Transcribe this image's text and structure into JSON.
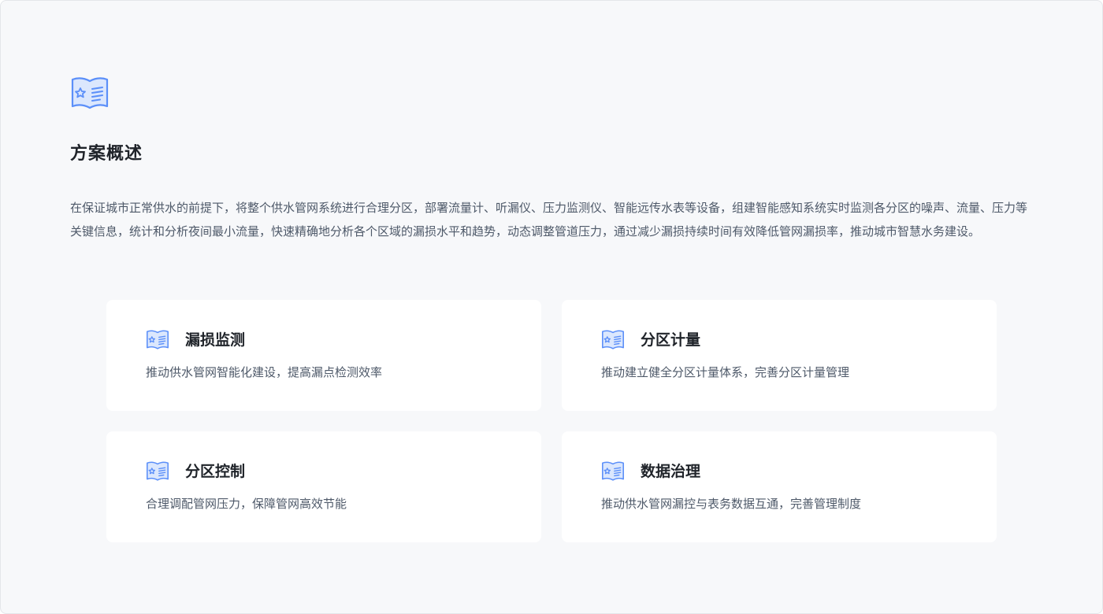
{
  "overview": {
    "icon": "book-star-icon",
    "title": "方案概述",
    "description": "在保证城市正常供水的前提下，将整个供水管网系统进行合理分区，部署流量计、听漏仪、压力监测仪、智能远传水表等设备，组建智能感知系统实时监测各分区的噪声、流量、压力等关键信息，统计和分析夜间最小流量，快速精确地分析各个区域的漏损水平和趋势，动态调整管道压力，通过减少漏损持续时间有效降低管网漏损率，推动城市智慧水务建设。"
  },
  "features": [
    {
      "icon": "book-star-icon",
      "title": "漏损监测",
      "description": "推动供水管网智能化建设，提高漏点检测效率"
    },
    {
      "icon": "book-star-icon",
      "title": "分区计量",
      "description": "推动建立健全分区计量体系，完善分区计量管理"
    },
    {
      "icon": "book-star-icon",
      "title": "分区控制",
      "description": "合理调配管网压力，保障管网高效节能"
    },
    {
      "icon": "book-star-icon",
      "title": "数据治理",
      "description": "推动供水管网漏控与表务数据互通，完善管理制度"
    }
  ],
  "colors": {
    "accent": "#5b8ff9",
    "accent_light": "#dbe7fd",
    "background": "#f7f8fa",
    "card": "#ffffff",
    "title": "#1f2329",
    "body_text": "#4e5969"
  }
}
